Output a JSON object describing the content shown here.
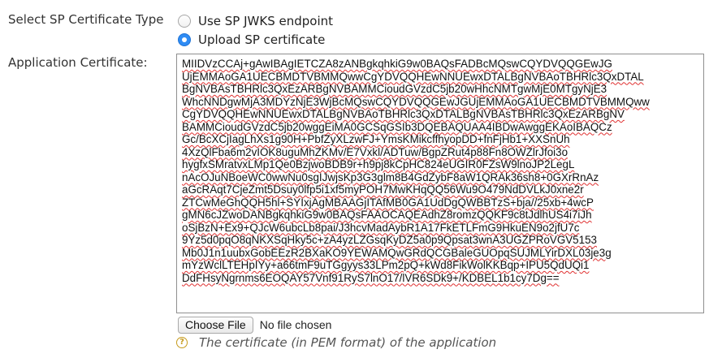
{
  "form": {
    "certificate_type": {
      "label": "Select SP Certificate Type",
      "options": [
        {
          "label": "Use SP JWKS endpoint",
          "selected": false
        },
        {
          "label": "Upload SP certificate",
          "selected": true
        }
      ]
    },
    "application_certificate": {
      "label": "Application Certificate:",
      "lines": [
        "MIIDVzCCAj+gAwIBAgIETCZA8zANBgkqhkiG9w0BAQsFADBcMQswCQYDVQQGEwJG",
        "UjEMMAoGA1UECBMDTVBMMQwwCgYDVQQHEwNNUEwxDTALBgNVBAoTBHRlc3QxDTAL",
        "BgNVBAsTBHRlc3QxEzARBgNVBAMMCioudGVzdC5jb20wHhcNMTgwMjE0MTgyNjE3",
        "WhcNNDgwMjA3MDYzNjE3WjBcMQswCQYDVQQGEwJGUjEMMAoGA1UECBMDTVBMMQww",
        "CgYDVQQHEwNNUEwxDTALBgNVBAoTBHRlc3QxDTALBgNVBAsTBHRlc3QxEzARBgNV",
        "BAMMCioudGVzdC5jb20wggEiMA0GCSqGSIb3DQEBAQUAA4IBDwAwggEKAoIBAQCz",
        "Gc/BcXCjIagLhXs1g90H+PbfZyXLzwFJ+YmsKMikcffhyopDD+fnFjHb1+XXSnUh",
        "4XzQlFba6m2vIOK8uguMhZKMv/E7Vxkl/ADTuw/BgpZRut4p88Fn8OWZlrJfoi3o",
        "hygfxSMratvxLMp1Qe0BzjwoBDB9r+h9pj8kCpHC824eUGIR0FZsW9lnoJP2LegL",
        "nAcOJuNBoeWC0wwNu0sgIJwjsKp3G3glm8B4GdZybF8aW1QRAk36sh8+0GXrRnAz",
        "aGcRAqt7CjeZmt5Dsuy0lfp5i1xf5myPOH7MwKHqQQ56Wu9O479NdDVLkJ0xne2r",
        "ZTCwMeGhQQH5hl+SYIxjAgMBAAGjITAfMB0GA1UdDgQWBBTzS+bja//25xb+4wcP",
        "gMN6cJZwoDANBgkqhkiG9w0BAQsFAAOCAQEAdhZ8romzQQKF9c8tJdlhUS4i7iJh",
        "oSjBzN+Ex9+QJcW6ubcLb8pai/J3hcvMadAybR1A17FkETLFmG9HkuEN9o2jfU7c",
        "9Yz5d0pqO8qNKXSqHky5c+zA4yzLZGsqKyDZ5a0p9Qpsat3wnA3UGZPRoVGV5153",
        "Mb0J1n1uubxGobEEzR2BXaKO9YEWAMQwGRdQCGBaleGUOpqSUJMLYirDXL03je3g",
        "mYzWclLTEHpIYy+a66tmF9uTGgyys33LPm2pQ+kWd8FikWolKKBqp+IPU5QdUQi1",
        "DdFHsyNgrnms6EOQAY57Vnf91RyS7lnO17/lVR6SDk9+/KDBEL1b1cy7Dg=="
      ]
    },
    "file_input": {
      "button_label": "Choose File",
      "status": "No file chosen"
    },
    "help": {
      "icon": "question-circle-icon",
      "text": "The certificate (in PEM format) of the application"
    }
  }
}
